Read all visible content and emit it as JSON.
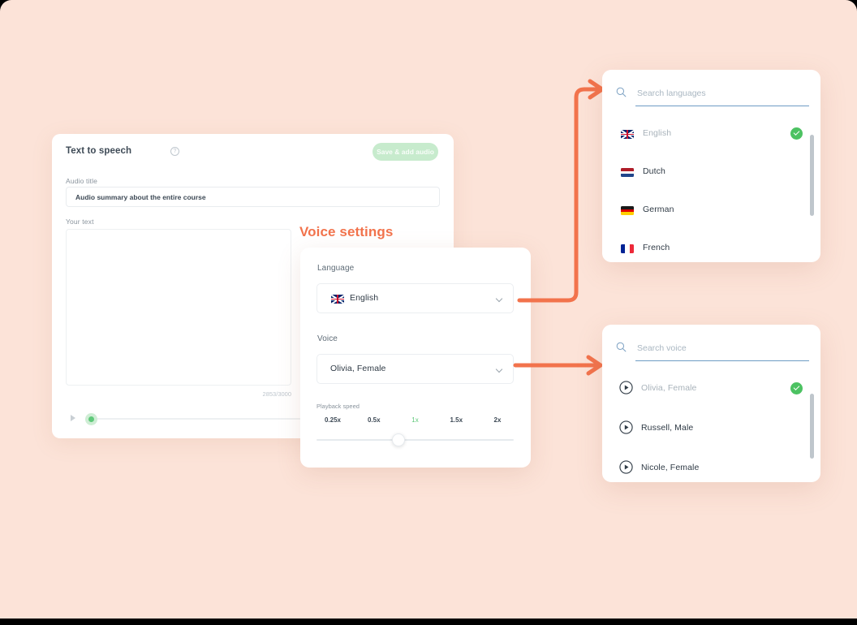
{
  "theme": {
    "page_background": "#FCE3D8",
    "accent_orange": "#F2734C",
    "accent_green": "#4CC262",
    "button_green": "#C7EBCD",
    "search_underline": "#6E9CC4"
  },
  "tts_card": {
    "title": "Text to speech",
    "help_icon": "help-circle-icon",
    "save_button": "Save & add audio",
    "audio_title_label": "Audio title",
    "audio_title_value": "Audio summary about the entire course",
    "your_text_label": "Your text",
    "your_text_value": "",
    "your_text_placeholder": "",
    "char_counter": "2853/3000",
    "player": {
      "play_icon": "play-icon",
      "progress_percent": 0
    }
  },
  "voice_settings": {
    "heading": "Voice settings",
    "language_label": "Language",
    "language_value": "English",
    "language_flag": "flag-uk",
    "voice_label": "Voice",
    "voice_value": "Olivia, Female",
    "playback_speed_label": "Playback speed",
    "speed_options": [
      {
        "label": "0.25x",
        "active": false
      },
      {
        "label": "0.5x",
        "active": false
      },
      {
        "label": "1x",
        "active": true
      },
      {
        "label": "1.5x",
        "active": false
      },
      {
        "label": "2x",
        "active": false
      }
    ],
    "speed_selected": "1x",
    "chevron_icon": "chevron-down-icon"
  },
  "language_panel": {
    "search_placeholder": "Search languages",
    "search_value": "",
    "search_icon": "search-icon",
    "options": [
      {
        "label": "English",
        "flag": "flag-uk",
        "selected": true
      },
      {
        "label": "Dutch",
        "flag": "flag-nl",
        "selected": false
      },
      {
        "label": "German",
        "flag": "flag-de",
        "selected": false
      },
      {
        "label": "French",
        "flag": "flag-fr",
        "selected": false
      }
    ]
  },
  "voice_panel": {
    "search_placeholder": "Search voice",
    "search_value": "",
    "search_icon": "search-icon",
    "options": [
      {
        "label": "Olivia, Female",
        "selected": true
      },
      {
        "label": "Russell, Male",
        "selected": false
      },
      {
        "label": "Nicole, Female",
        "selected": false
      }
    ]
  }
}
